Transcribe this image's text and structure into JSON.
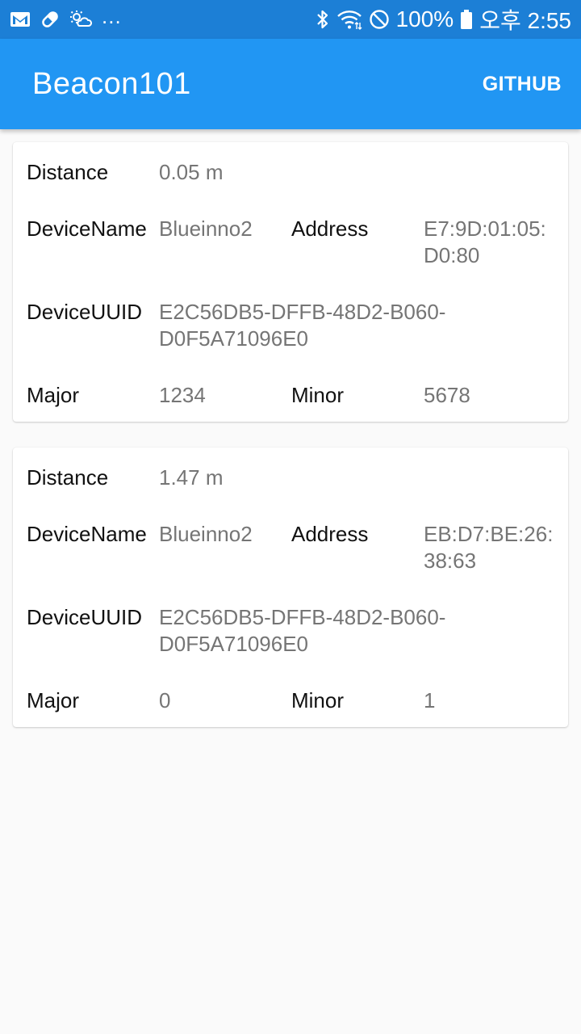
{
  "status_bar": {
    "left_icons": [
      "gmail-icon",
      "pill-icon",
      "weather-icon"
    ],
    "overflow": "...",
    "battery_percent": "100%",
    "time": "오후 2:55",
    "background_color": "#1c7fd6"
  },
  "app_bar": {
    "title": "Beacon101",
    "action_label": "GITHUB",
    "color": "#2196f3"
  },
  "labels": {
    "distance": "Distance",
    "device_name": "DeviceName",
    "address": "Address",
    "device_uuid": "DeviceUUID",
    "major": "Major",
    "minor": "Minor"
  },
  "beacons": [
    {
      "distance": "0.05 m",
      "device_name": "Blueinno2",
      "address_line1": "E7:9D:01:05:",
      "address_line2": "D0:80",
      "uuid_line1": "E2C56DB5-DFFB-48D2-B060-",
      "uuid_line2": "D0F5A71096E0",
      "major": "1234",
      "minor": "5678"
    },
    {
      "distance": "1.47 m",
      "device_name": "Blueinno2",
      "address_line1": "EB:D7:BE:26:",
      "address_line2": "38:63",
      "uuid_line1": "E2C56DB5-DFFB-48D2-B060-",
      "uuid_line2": "D0F5A71096E0",
      "major": "0",
      "minor": "1"
    }
  ]
}
